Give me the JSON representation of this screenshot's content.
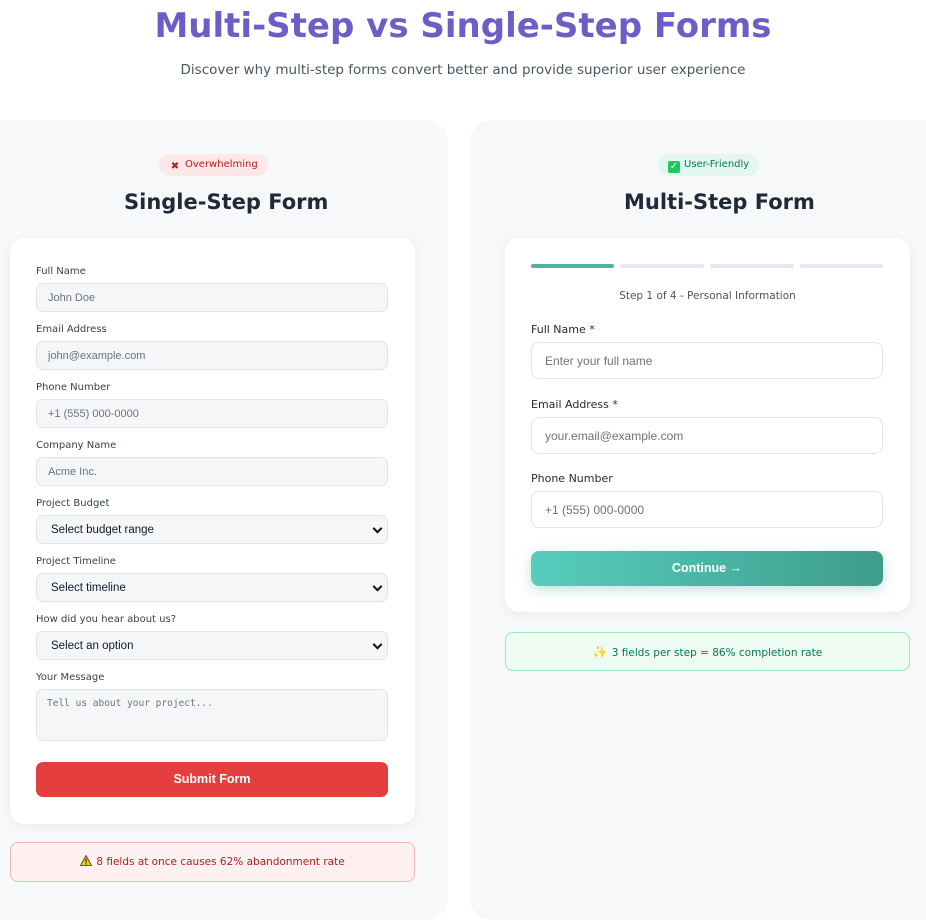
{
  "header": {
    "title": "Multi-Step vs Single-Step Forms",
    "subtitle": "Discover why multi-step forms convert better and provide superior user experience"
  },
  "single_step": {
    "badge": "Overwhelming",
    "badge_icon": "cross-mark-icon",
    "title": "Single-Step Form",
    "fields": {
      "full_name_label": "Full Name",
      "full_name_placeholder": "John Doe",
      "email_label": "Email Address",
      "email_placeholder": "john@example.com",
      "phone_label": "Phone Number",
      "phone_placeholder": "+1 (555) 000-0000",
      "company_label": "Company Name",
      "company_placeholder": "Acme Inc.",
      "budget_label": "Project Budget",
      "budget_value": "Select budget range",
      "timeline_label": "Project Timeline",
      "timeline_value": "Select timeline",
      "source_label": "How did you hear about us?",
      "source_value": "Select an option",
      "message_label": "Your Message",
      "message_placeholder": "Tell us about your project..."
    },
    "submit_label": "Submit Form",
    "stat_icon": "warning-icon",
    "stat": "8 fields at once causes 62% abandonment rate"
  },
  "multi_step": {
    "badge": "User-Friendly",
    "badge_icon": "check-mark-icon",
    "title": "Multi-Step Form",
    "progress": {
      "current": 1,
      "total": 4
    },
    "step_text": "Step 1 of 4 - Personal Information",
    "fields": {
      "full_name_label": "Full Name *",
      "full_name_placeholder": "Enter your full name",
      "email_label": "Email Address *",
      "email_placeholder": "your.email@example.com",
      "phone_label": "Phone Number",
      "phone_placeholder": "+1 (555) 000-0000"
    },
    "continue_label": "Continue →",
    "stat_icon": "sparkles-icon",
    "stat": "3 fields per step = 86% completion rate"
  },
  "colors": {
    "title": "#6b5fc7",
    "submit": "#e53e3e",
    "continue_start": "#57cdbd",
    "continue_end": "#3e9d8d",
    "progress_active": "#4fb3a3"
  }
}
